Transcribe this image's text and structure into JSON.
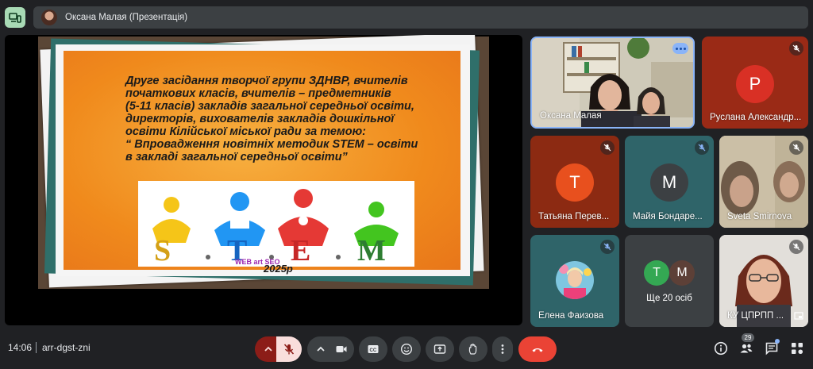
{
  "presenter": {
    "title": "Оксана Малая (Презентація)"
  },
  "slide": {
    "lines": [
      "Друге засідання творчої групи ЗДНВР, вчителів",
      "початкових класів, вчителів – предметників",
      "(5-11 класів) закладів загальної середньої освіти,",
      "директорів, вихователів закладів дошкільної",
      "освіти Кілійської міської ради за темою:",
      "“ Впровадження новітніх методик STEM – освіти",
      "в закладі загальної середньої освіти”"
    ],
    "stem_letters": [
      "S",
      "T",
      "E",
      "M"
    ],
    "logo_text": "WEB art SEO",
    "year": "2025р"
  },
  "participants": [
    {
      "name": "Оксана Малая",
      "type": "video"
    },
    {
      "name": "Руслана Александр...",
      "initial": "P",
      "avatar_color": "#d93025",
      "tile_color": "#9a2a16"
    },
    {
      "name": "Татьяна Перев...",
      "initial": "T",
      "avatar_color": "#e8501e",
      "tile_color": "#8c2a12"
    },
    {
      "name": "Майя Бондаре...",
      "initial": "M",
      "avatar_color": "#3c4043",
      "tile_color": "#2f6469"
    },
    {
      "name": "Sveta Smirnova",
      "type": "video"
    },
    {
      "name": "Елена Фаизова",
      "type": "photo"
    },
    {
      "name": "Ще 20 осіб",
      "initials": [
        "T",
        "M"
      ]
    },
    {
      "name": "КУ ЦПРПП ...",
      "type": "video"
    }
  ],
  "bottom": {
    "time": "14:06",
    "meeting_code": "arr-dgst-zni",
    "people_count": "29"
  },
  "colors": {
    "background": "#202124",
    "accent_blue": "#8ab4f8",
    "end_call": "#ea4335",
    "present_green": "#a8dab5"
  }
}
